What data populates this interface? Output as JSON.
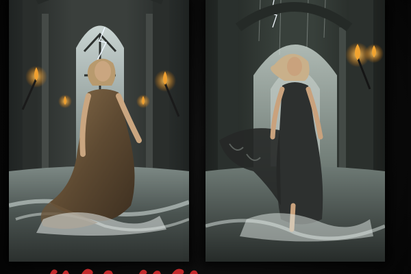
{
  "panels": [
    {
      "name": "left-artwork",
      "subject": "woman-in-bronze-gown",
      "accent": "#c8781e"
    },
    {
      "name": "right-artwork",
      "subject": "woman-in-black-gown",
      "accent": "#e0902a"
    }
  ],
  "colors": {
    "background": "#0b0b0b",
    "stone": "#3a3d3b",
    "water": "#b9c2bf",
    "flame": "#f0a030",
    "caption": "#c0282a"
  }
}
